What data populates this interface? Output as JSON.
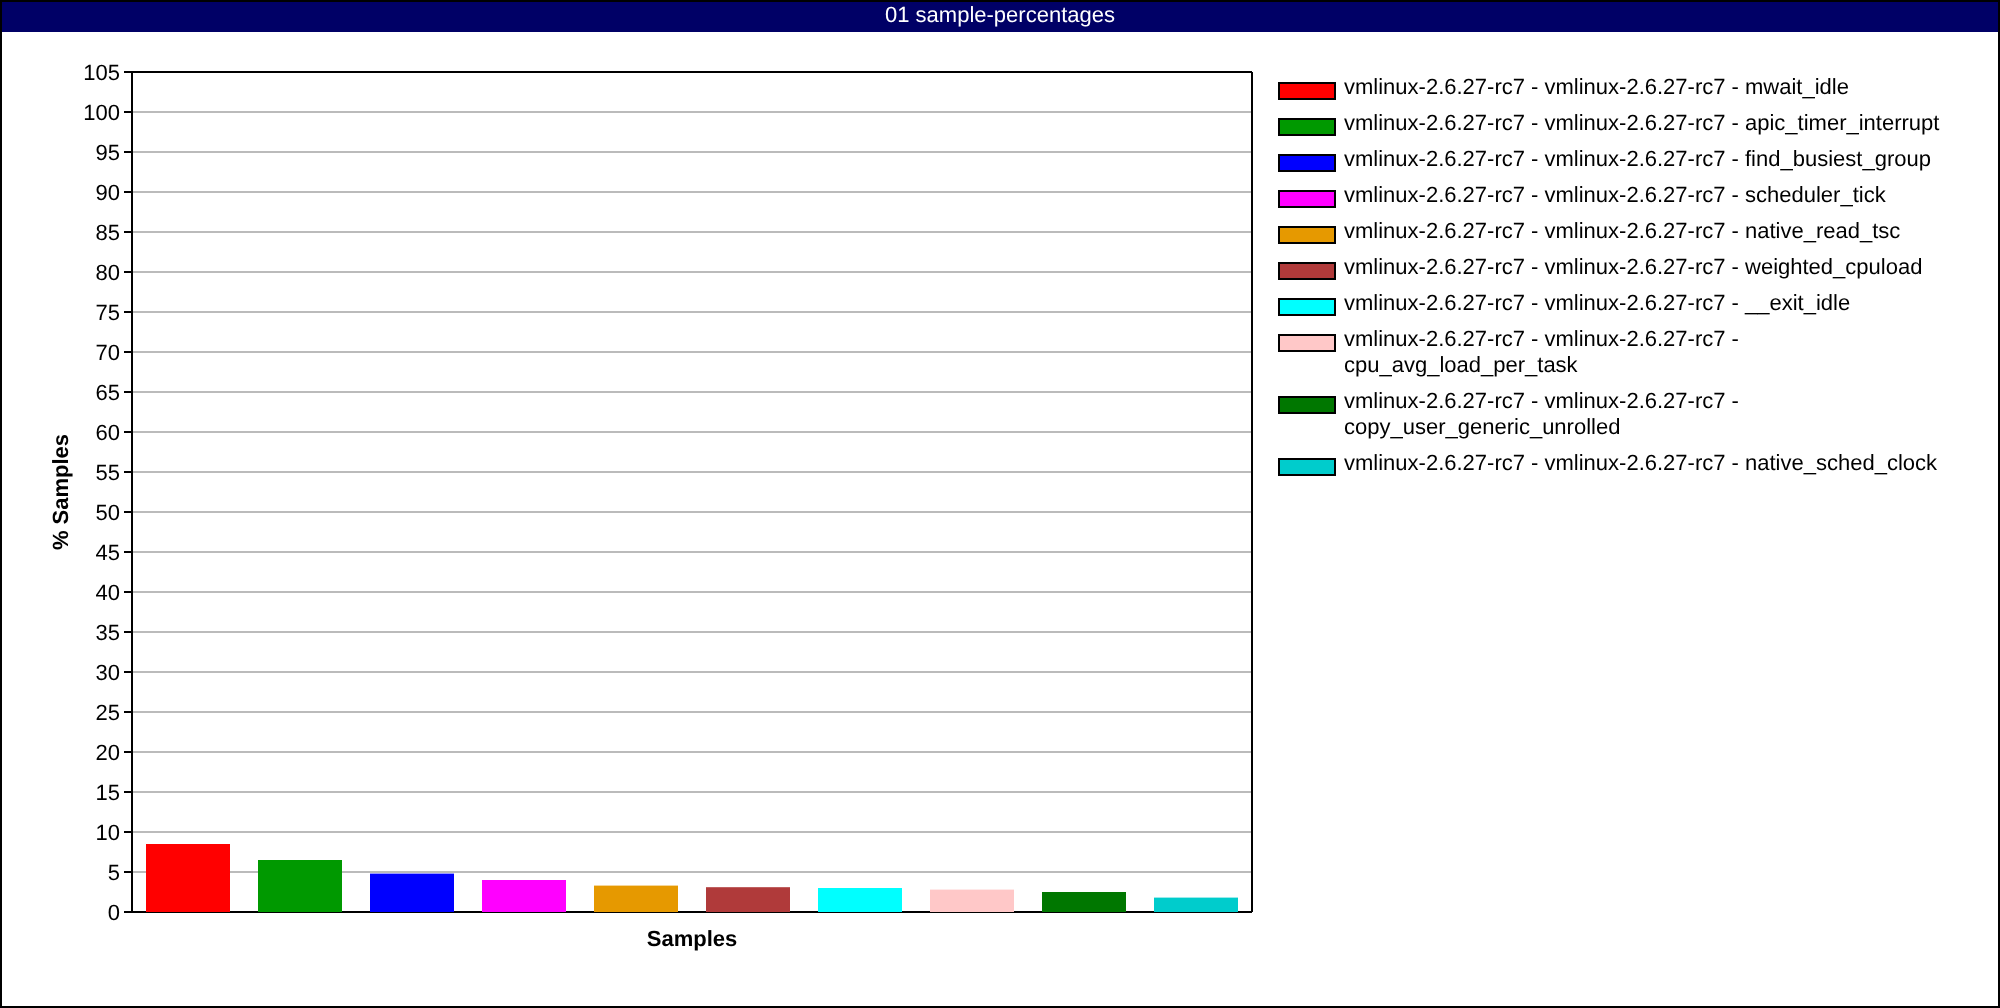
{
  "chart_data": {
    "type": "bar",
    "title": "01 sample-percentages",
    "xlabel": "Samples",
    "ylabel": "% Samples",
    "ylim": [
      0,
      105
    ],
    "grid": true,
    "legend": "right",
    "yticks": [
      0,
      5,
      10,
      15,
      20,
      25,
      30,
      35,
      40,
      45,
      50,
      55,
      60,
      65,
      70,
      75,
      80,
      85,
      90,
      95,
      100,
      105
    ],
    "series": [
      {
        "name": "vmlinux-2.6.27-rc7 - vmlinux-2.6.27-rc7 - mwait_idle",
        "color": "#ff0000",
        "values": [
          8.5
        ]
      },
      {
        "name": "vmlinux-2.6.27-rc7 - vmlinux-2.6.27-rc7 - apic_timer_interrupt",
        "color": "#009900",
        "values": [
          6.5
        ]
      },
      {
        "name": "vmlinux-2.6.27-rc7 - vmlinux-2.6.27-rc7 - find_busiest_group",
        "color": "#0000ff",
        "values": [
          4.8
        ]
      },
      {
        "name": "vmlinux-2.6.27-rc7 - vmlinux-2.6.27-rc7 - scheduler_tick",
        "color": "#ff00ff",
        "values": [
          4.0
        ]
      },
      {
        "name": "vmlinux-2.6.27-rc7 - vmlinux-2.6.27-rc7 - native_read_tsc",
        "color": "#e69900",
        "values": [
          3.3
        ]
      },
      {
        "name": "vmlinux-2.6.27-rc7 - vmlinux-2.6.27-rc7 - weighted_cpuload",
        "color": "#b03a3a",
        "values": [
          3.1
        ]
      },
      {
        "name": "vmlinux-2.6.27-rc7 - vmlinux-2.6.27-rc7 - __exit_idle",
        "color": "#00ffff",
        "values": [
          3.0
        ]
      },
      {
        "name": "vmlinux-2.6.27-rc7 - vmlinux-2.6.27-rc7 - cpu_avg_load_per_task",
        "color": "#ffc8c8",
        "values": [
          2.8
        ]
      },
      {
        "name": "vmlinux-2.6.27-rc7 - vmlinux-2.6.27-rc7 - copy_user_generic_unrolled",
        "color": "#007700",
        "values": [
          2.5
        ]
      },
      {
        "name": "vmlinux-2.6.27-rc7 - vmlinux-2.6.27-rc7 - native_sched_clock",
        "color": "#00cccc",
        "values": [
          1.8
        ]
      }
    ]
  }
}
